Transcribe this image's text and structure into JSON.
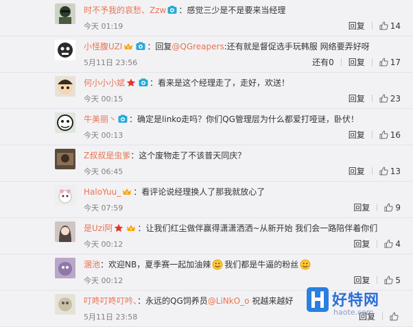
{
  "comments": [
    {
      "user": "时不予我的哀愁、Zzw",
      "badges": [
        "camera"
      ],
      "sep": "：",
      "text": "感觉三少是不是要来当经理",
      "time": "今天 01:19",
      "reply": "回复",
      "likes": "14",
      "avatar": "a1"
    },
    {
      "user": "小怪腹UZI",
      "badges": [
        "vip",
        "camera"
      ],
      "sep": "：",
      "text": "回复",
      "mention": "@QGreapers",
      "text2": ":还有就是督促选手玩韩服 网络要弄好呀",
      "time": "5月11日 23:56",
      "extra": "还有0",
      "reply": "回复",
      "likes": "17",
      "avatar": "a2"
    },
    {
      "user": "何小小小斌",
      "badges": [
        "star",
        "camera"
      ],
      "sep": "：",
      "text": "看来是这个经理走了，走好，欢送！",
      "time": "今天 00:15",
      "reply": "回复",
      "likes": "23",
      "avatar": "a3"
    },
    {
      "user": "牛美丽丶",
      "badges": [
        "camera"
      ],
      "sep": "：",
      "text": "确定是linko走吗？你们QG管理层为什么都爱打哑谜，卧伏！",
      "time": "今天 00:13",
      "reply": "回复",
      "likes": "16",
      "avatar": "a4"
    },
    {
      "user": "Z叔叔是虫爹",
      "badges": [],
      "sep": "：",
      "text": "这个废物走了不该普天同庆？",
      "time": "今天 06:45",
      "reply": "回复",
      "likes": "13",
      "avatar": "a5"
    },
    {
      "user": "HaloYuu_",
      "badges": [
        "vip"
      ],
      "sep": "：",
      "text": "看评论说经理换人了那我就放心了",
      "time": "今天 07:59",
      "reply": "回复",
      "likes": "9",
      "avatar": "a6"
    },
    {
      "user": "是Uzi阿",
      "badges": [
        "star",
        "vip"
      ],
      "sep": "：",
      "text": "让我们红尘做伴赢得潇潇洒洒~从新开始 我们会一路陪伴着你们",
      "time": "今天 00:12",
      "reply": "回复",
      "likes": "4",
      "avatar": "a7"
    },
    {
      "user": "溷池",
      "badges": [],
      "sep": "：",
      "text": "欢迎NB，夏季赛一起加油辣",
      "emoji1": true,
      "text2": "我们都是牛逼的粉丝",
      "emoji2": true,
      "time": "今天 00:12",
      "reply": "回复",
      "likes": "5",
      "avatar": "a8"
    },
    {
      "user": "叮咚叮咚叮吟、",
      "badges": [],
      "sep": "：",
      "text": "永远的QG饲养员",
      "mention": "@LiNkO_o",
      "text2": " 祝越来越好",
      "time": "5月11日 23:58",
      "reply": "回复",
      "likes": "",
      "avatar": "a9"
    }
  ],
  "watermark": {
    "brand": "好特网",
    "url": "haote.com"
  },
  "colors": {
    "name": "#eb7350",
    "text": "#333333",
    "time": "#808080",
    "bg": "#f2f2f5"
  }
}
